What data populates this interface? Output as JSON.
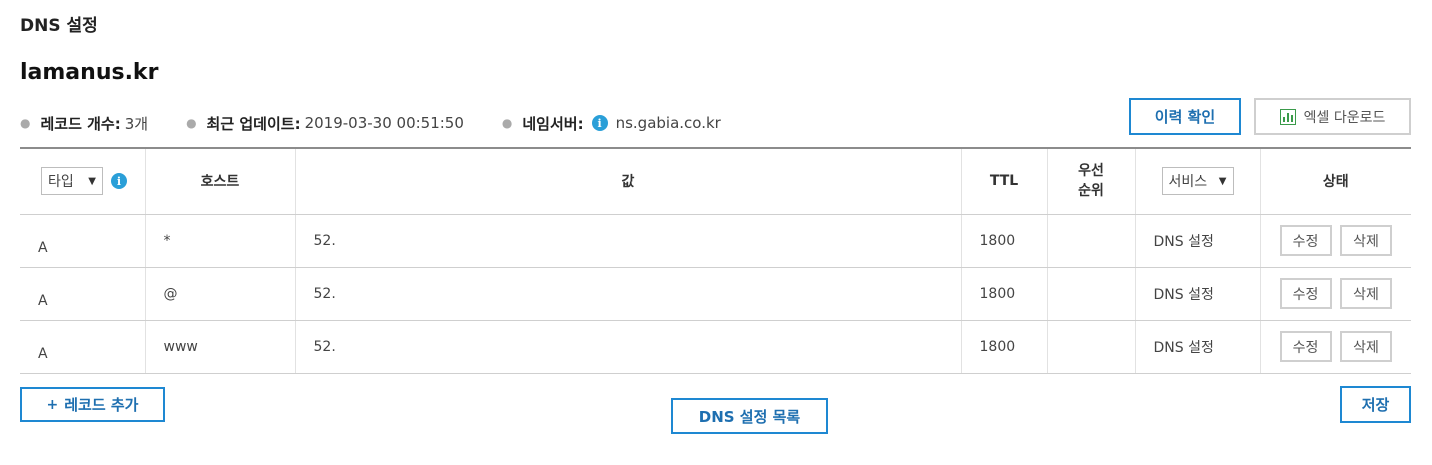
{
  "header": {
    "title": "DNS 설정"
  },
  "domain": {
    "name": "lamanus.kr"
  },
  "info": {
    "record_count_label": "레코드 개수:",
    "record_count_value": "3개",
    "updated_label": "최근 업데이트:",
    "updated_value": "2019-03-30 00:51:50",
    "nameserver_label": "네임서버:",
    "nameserver_value": "ns.gabia.co.kr"
  },
  "buttons": {
    "history": "이력 확인",
    "excel": "엑셀 다운로드",
    "add_record": "레코드 추가",
    "dns_list": "DNS 설정 목록",
    "save": "저장"
  },
  "table": {
    "headers": {
      "type": "타입",
      "host": "호스트",
      "value": "값",
      "ttl": "TTL",
      "priority_line1": "우선",
      "priority_line2": "순위",
      "service": "서비스",
      "status": "상태"
    },
    "rows": [
      {
        "type": "A",
        "host": "*",
        "value": "52.",
        "ttl": "1800",
        "priority": "",
        "service": "DNS 설정",
        "edit": "수정",
        "delete": "삭제"
      },
      {
        "type": "A",
        "host": "@",
        "value": "52.",
        "ttl": "1800",
        "priority": "",
        "service": "DNS 설정",
        "edit": "수정",
        "delete": "삭제"
      },
      {
        "type": "A",
        "host": "www",
        "value": "52.",
        "ttl": "1800",
        "priority": "",
        "service": "DNS 설정",
        "edit": "수정",
        "delete": "삭제"
      }
    ]
  },
  "icons": {
    "info": "info-icon",
    "excel": "excel-chart-icon",
    "dropdown": "chevron-down-icon",
    "plus": "plus-icon"
  },
  "colors": {
    "accent": "#1e88d2",
    "info_icon": "#2a9fd8",
    "excel_icon": "#3a9a4a"
  }
}
